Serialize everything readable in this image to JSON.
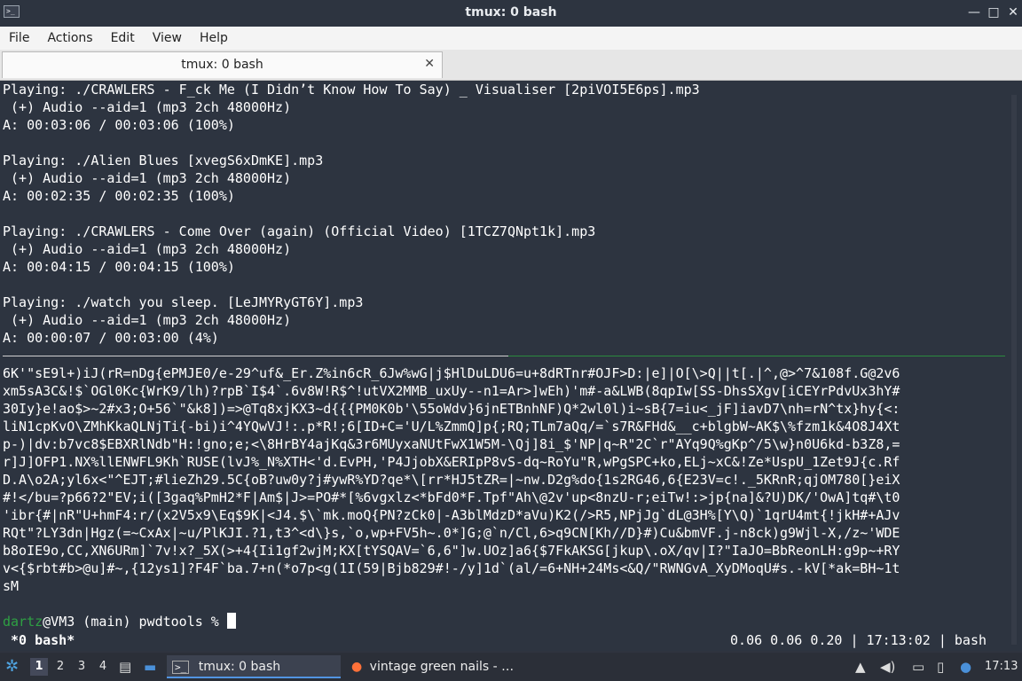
{
  "window": {
    "title": "tmux: 0 bash",
    "app_icon_text": ">_",
    "minimize": "—",
    "maximize": "□",
    "close": "✕"
  },
  "menu": [
    "File",
    "Actions",
    "Edit",
    "View",
    "Help"
  ],
  "tab": {
    "label": "tmux: 0 bash",
    "close": "✕"
  },
  "terminal": {
    "lines": [
      "Playing: ./CRAWLERS - F_ck Me (I Didn’t Know How To Say) _ Visualiser [2piVOI5E6ps].mp3",
      " (+) Audio --aid=1 (mp3 2ch 48000Hz)",
      "A: 00:03:06 / 00:03:06 (100%)",
      "",
      "Playing: ./Alien Blues [xvegS6xDmKE].mp3",
      " (+) Audio --aid=1 (mp3 2ch 48000Hz)",
      "A: 00:02:35 / 00:02:35 (100%)",
      "",
      "Playing: ./CRAWLERS - Come Over (again) (Official Video) [1TCZ7QNpt1k].mp3",
      " (+) Audio --aid=1 (mp3 2ch 48000Hz)",
      "A: 00:04:15 / 00:04:15 (100%)",
      "",
      "Playing: ./watch you sleep. [LeJMYRyGT6Y].mp3",
      " (+) Audio --aid=1 (mp3 2ch 48000Hz)",
      "A: 00:00:07 / 00:03:00 (4%)"
    ],
    "lower_lines": [
      "6K'\"sE9l+)iJ(rR=nDg{ePMJE0/e-29^uf&_Er.Z%in6cR_6Jw%wG|j$HlDuLDU6=u+8dRTnr#OJF>D:|e]|O[\\>Q||t[.|^,@>^7&108f.G@2v6",
      "xm5sA3C&!$`OGl0Kc{WrK9/lh)?rpB`I$4`.6v8W!R$^!utVX2MMB_uxUy--n1=Ar>]wEh)'m#-a&LWB(8qpIw[SS-DhsSXgv[iCEYrPdvUx3hY#",
      "30Iy}e!ao$>~2#x3;O+56`\"&k8])=>@Tq8xjKX3~d{{{PM0K0b'\\55oWdv}6jnETBnhNF)Q*2wl0l)i~sB{7=iu<_jF]iavD7\\nh=rN^tx}hy{<:",
      "liN1cpKvO\\ZMhKkaQLNjTi{-bi)i^4YQwVJ!:.p*R!;6[ID+C='U/L%ZmmQ]p{;RQ;TLm7aQq/=`s7R&FHd&__c+blgbW~AK$\\%fzm1k&4O8J4Xt",
      "p-)|dv:b7vc8$EBXRlNdb\"H:!gno;e;<\\8HrBY4ajKq&3r6MUyxaNUtFwX1W5M-\\Qj]8i_$'NP|q~R\"2C`r\"AYq9Q%gKp^/5\\w}n0U6kd-b3Z8,=",
      "r]J]OFP1.NX%llENWFL9Kh`RUSE(lvJ%_N%XTH<'d.EvPH,'P4JjobX&ERIpP8vS-dq~RoYu\"R,wPgSPC+ko,ELj~xC&!Ze*UspU_1Zet9J{c.Rf",
      "D.A\\o2A;yl6x<\"^EJT;#lieZh29.5C{oB?uw0y?j#ywR%YD?qe*\\[rr*HJ5tZR=|~nw.D2g%do{1s2RG46,6{E23V=c!._5KRnR;qjOM780[}eiX",
      "#!</bu=?p66?2\"EV;i([3gaq%PmH2*F|Am$|J>=PO#*[%6vgxlz<*bFd0*F.Tpf\"Ah\\@2v'up<8nzU-r;eiTw!:>jp{na]&?U)DK/'OwA]tq#\\t0",
      "'ibr{#|nR\"U+hmF4:r/(x2V5x9\\Eq$9K|<J4.$\\`mk.moQ{PN?zCk0|-A3blMdzD*aVu)K2(/>R5,NPjJg`dL@3H%[Y\\Q)`1qrU4mt{!jkH#+AJv",
      "RQt\"?LY3dn|Hgz(=~CxAx|~u/PlKJI.?1,t3^<d\\}s,`o,wp+FV5h~.0*]G;@`n/Cl,6>q9CN[Kh//D}#)Cu&bmVF.j-n8ck)g9Wjl-X,/z~'WDE",
      "b8oIE9o,CC,XN6URm]`7v!x?_5X(>+4{Ii1gf2wjM;KX[tYSQAV=`6,6\"]w.UOz]a6{$7FkAKSG[jkup\\.oX/qv|I?\"IaJO=BbReonLH:g9p~+RY",
      "v<{$rbt#b>@u]#~,{12ys1]?F4F`ba.7+n(*o7p<g(1I(59|Bjb829#!-/y]1d`(al/=6+NH+24Ms<&Q/\"RWNGvA_XyDMoqU#s.-kV[*ak=BH~1t",
      "sM"
    ],
    "prompt": {
      "user": "dartz",
      "rest": "@VM3 (main) pwdtools % "
    }
  },
  "tmux_status": {
    "left": "*0 bash*",
    "right": "0.06 0.06 0.20 | 17:13:02 | bash"
  },
  "taskbar": {
    "workspaces": [
      "1",
      "2",
      "3",
      "4"
    ],
    "tasks": [
      "tmux: 0 bash",
      "vintage green nails - …"
    ],
    "clock": "17:13"
  }
}
